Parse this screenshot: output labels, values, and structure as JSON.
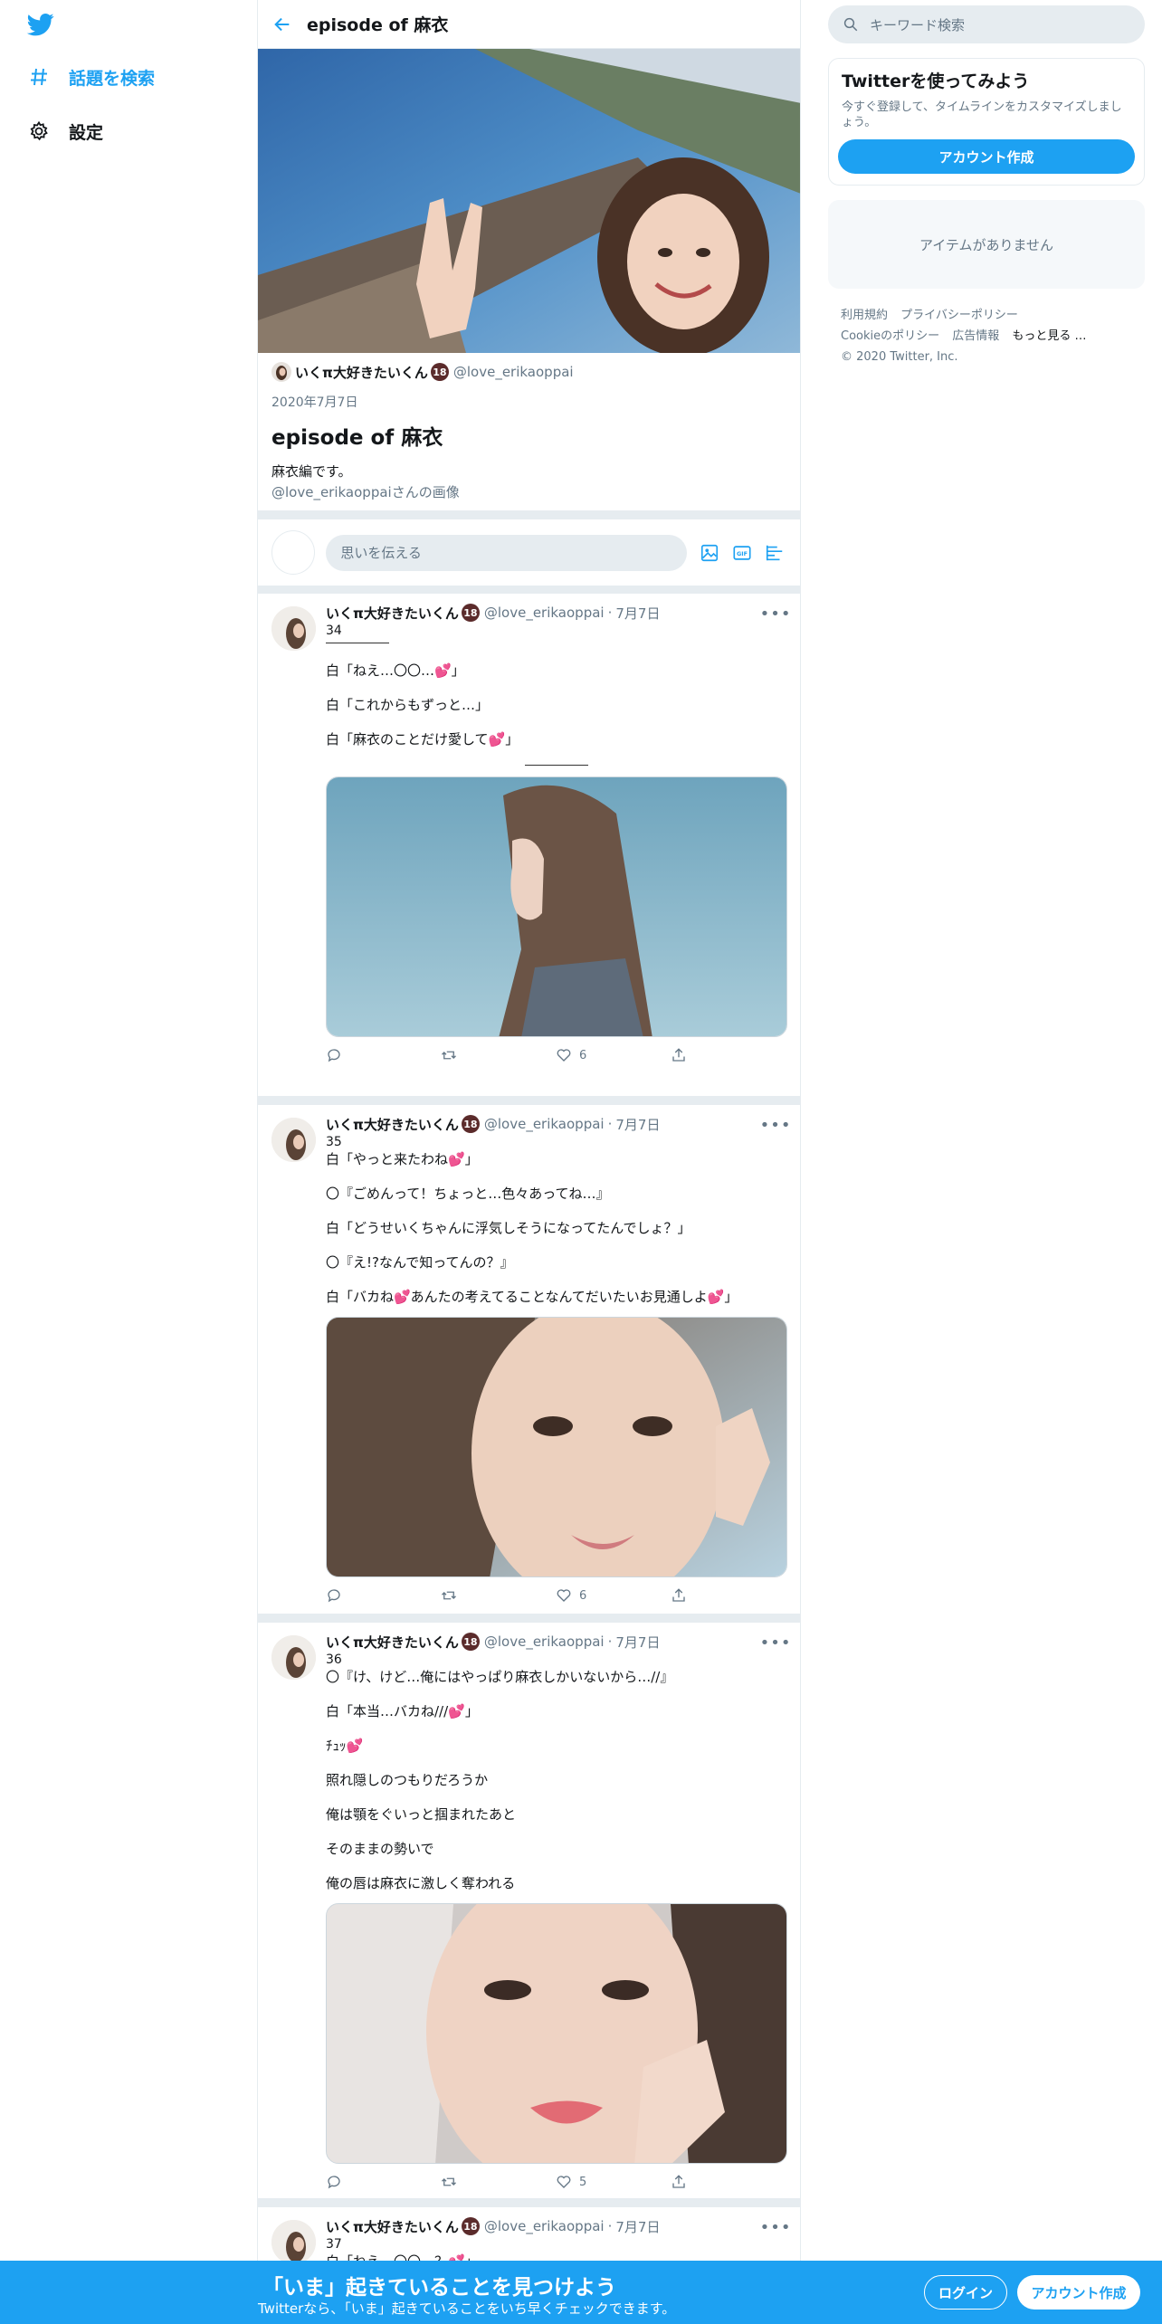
{
  "nav": {
    "items": [
      {
        "label": "話題を検索",
        "icon": "hashtag-icon"
      },
      {
        "label": "設定",
        "icon": "gear-icon"
      }
    ]
  },
  "header": {
    "title": "episode of 麻衣"
  },
  "moment": {
    "author_name": "いくπ大好きたいくん",
    "badge": "18",
    "author_handle": "@love_erikaoppai",
    "date": "2020年7月7日",
    "title": "episode of 麻衣",
    "description": "麻衣編です。",
    "image_credit": "@love_erikaoppaiさんの画像"
  },
  "compose": {
    "placeholder": "思いを伝える"
  },
  "tweets": [
    {
      "name": "いくπ大好きたいくん",
      "badge": "18",
      "handle": "@love_erikaoppai",
      "date": "7月7日",
      "number": "34",
      "lines": [
        "白「ねえ…〇〇…💕」",
        "白「これからもずっと…」",
        "白「麻衣のことだけ愛して💕」"
      ],
      "likes": "6"
    },
    {
      "name": "いくπ大好きたいくん",
      "badge": "18",
      "handle": "@love_erikaoppai",
      "date": "7月7日",
      "number": "35",
      "lines": [
        "白「やっと来たわね💕」",
        "〇『ごめんって！ちょっと…色々あってね…』",
        "白「どうせいくちゃんに浮気しそうになってたんでしょ？」",
        "〇『え!?なんで知ってんの？』",
        "白「バカね💕あんたの考えてることなんてだいたいお見通しよ💕」"
      ],
      "likes": "6"
    },
    {
      "name": "いくπ大好きたいくん",
      "badge": "18",
      "handle": "@love_erikaoppai",
      "date": "7月7日",
      "number": "36",
      "lines": [
        "〇『け、けど…俺にはやっぱり麻衣しかいないから…//』",
        "白「本当…バカね///💕」",
        "ﾁｭｯ💕",
        "照れ隠しのつもりだろうか",
        "俺は顎をぐいっと掴まれたあと",
        "そのままの勢いで",
        "俺の唇は麻衣に激しく奪われる"
      ],
      "likes": "5"
    },
    {
      "name": "いくπ大好きたいくん",
      "badge": "18",
      "handle": "@love_erikaoppai",
      "date": "7月7日",
      "number": "37",
      "lines": [
        "白「ねえ…〇〇…？💕」"
      ]
    }
  ],
  "sidebar": {
    "search_placeholder": "キーワード検索",
    "signup_title": "Twitterを使ってみよう",
    "signup_desc": "今すぐ登録して、タイムラインをカスタマイズしましょう。",
    "signup_button": "アカウント作成",
    "empty_text": "アイテムがありません",
    "footer": [
      "利用規約",
      "プライバシーポリシー",
      "Cookieのポリシー",
      "広告情報",
      "もっと見る …",
      "© 2020 Twitter, Inc."
    ]
  },
  "bottombar": {
    "title": "「いま」起きていることを見つけよう",
    "subtitle": "Twitterなら、「いま」起きていることをいち早くチェックできます。",
    "login": "ログイン",
    "signup": "アカウント作成"
  },
  "colors": {
    "accent": "#1da1f2",
    "border": "#e6ecf0",
    "muted": "#657786"
  }
}
